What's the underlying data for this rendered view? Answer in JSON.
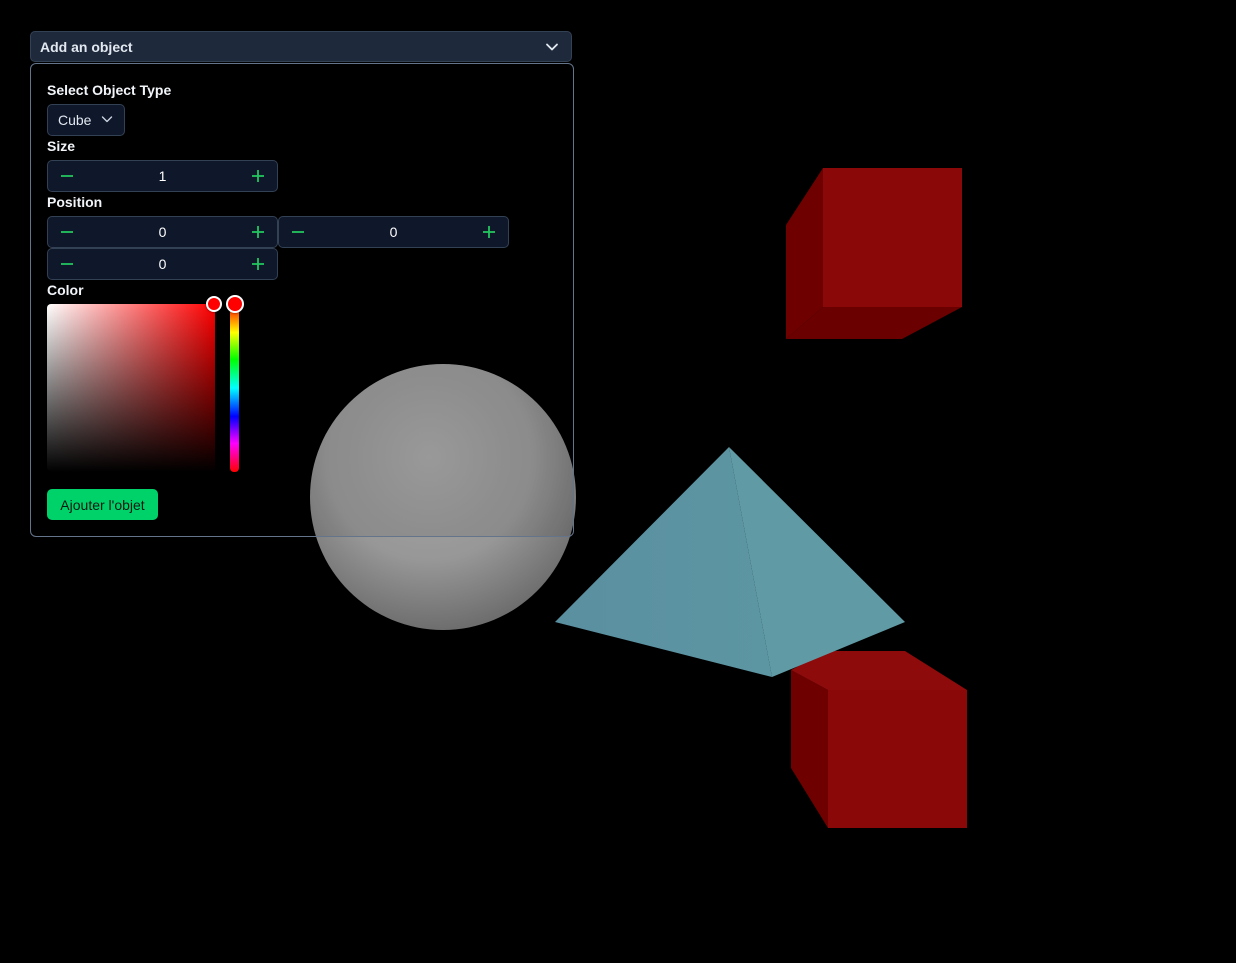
{
  "header": {
    "title": "Add an object",
    "icon": "chevron-down-icon"
  },
  "form": {
    "object_type_label": "Select Object Type",
    "object_type_value": "Cube",
    "size_label": "Size",
    "size_value": "1",
    "position_label": "Position",
    "position_x": "0",
    "position_y": "0",
    "position_z": "0",
    "color_label": "Color",
    "color_value": "#ff0000",
    "submit_label": "Ajouter l'objet"
  },
  "colors": {
    "accent": "#00d26a",
    "panel_header": "#1e293b",
    "input_bg": "#0f172a",
    "cube": "#8b0000",
    "pyramid": "#5f9aa5",
    "sphere": "#9a9a9a"
  },
  "scene_objects": [
    {
      "type": "cube",
      "color": "#8b0000"
    },
    {
      "type": "sphere",
      "color": "#9a9a9a"
    },
    {
      "type": "pyramid",
      "color": "#5f9aa5"
    },
    {
      "type": "cube",
      "color": "#8b0000"
    }
  ]
}
